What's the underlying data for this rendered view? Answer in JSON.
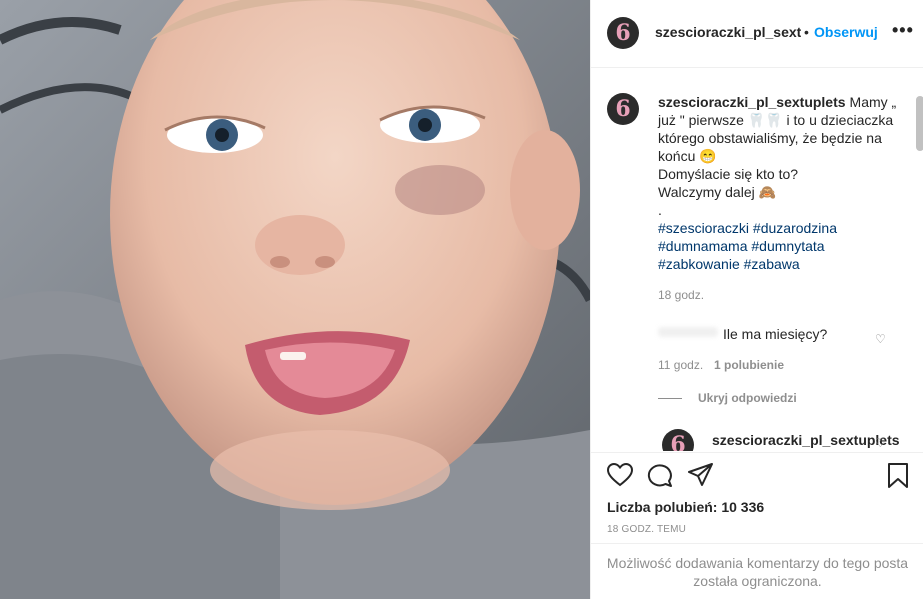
{
  "header": {
    "username": "szescioraczki_pl_sextuplets",
    "dot": "•",
    "follow_label": "Obserwuj",
    "more_label": "•••"
  },
  "caption": {
    "username": "szescioraczki_pl_sextuplets",
    "line1": "Mamy „ już \" pierwsze 🦷🦷 i to u dzieciaczka którego obstawialiśmy, że będzie na końcu 😁",
    "line2": "Domyślacie się kto to?",
    "line3": "Walczymy dalej 🙈",
    "line4": ".",
    "hashtags": [
      "#szescioraczki",
      "#duzarodzina",
      "#dumnamama",
      "#dumnytata",
      "#zabkowanie",
      "#zabawa"
    ],
    "time": "18 godz."
  },
  "comments": [
    {
      "text": "Ile ma miesięcy?",
      "time": "11 godz.",
      "likes": "1 polubienie"
    }
  ],
  "replies": {
    "hide_label": "Ukryj odpowiedzi",
    "reply_username": "szescioraczki_pl_sextuplets"
  },
  "actions": {
    "icons": [
      "heart-icon",
      "comment-icon",
      "share-icon",
      "bookmark-icon"
    ],
    "likes_text": "Liczba polubień: 10 336",
    "posted_ago": "18 GODZ. TEMU",
    "comments_limited": "Możliwość dodawania komentarzy do tego posta została ograniczona."
  },
  "colors": {
    "accent_blue": "#0095f6",
    "hashtag_blue": "#00376b",
    "secondary_text": "#8e8e8e",
    "border": "#efefef"
  }
}
